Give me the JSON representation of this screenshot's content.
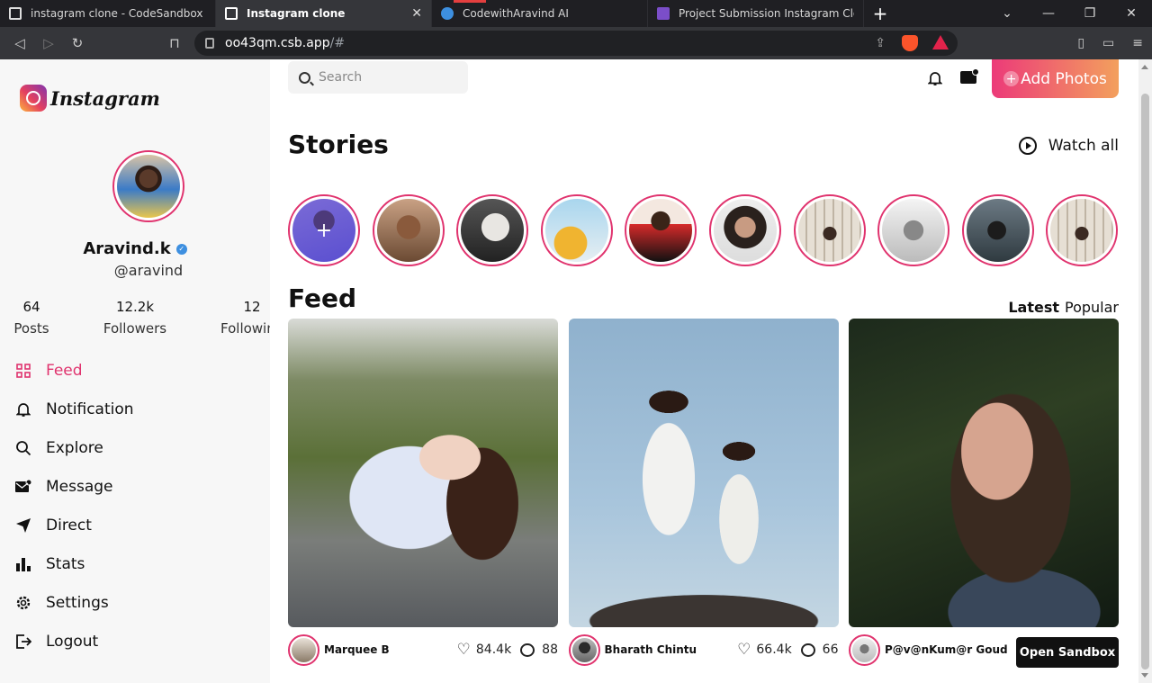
{
  "browser": {
    "tabs": [
      {
        "title": "instagram clone - CodeSandbox",
        "active": false
      },
      {
        "title": "Instagram clone",
        "active": true
      },
      {
        "title": "CodewithAravind AI",
        "active": false
      },
      {
        "title": "Project Submission Instagram Clone |",
        "active": false
      }
    ],
    "new_tab": "+",
    "url_host": "oo43qm.csb.app",
    "url_path": "/#"
  },
  "sidebar": {
    "logo_text": "Instagram",
    "profile": {
      "name": "Aravind.k",
      "handle": "@aravind"
    },
    "stats": [
      {
        "value": "64",
        "label": "Posts"
      },
      {
        "value": "12.2k",
        "label": "Followers"
      },
      {
        "value": "12",
        "label": "Following"
      }
    ],
    "menu": [
      {
        "label": "Feed",
        "icon": "grid-icon",
        "active": true
      },
      {
        "label": "Notification",
        "icon": "bell-icon",
        "active": false
      },
      {
        "label": "Explore",
        "icon": "search-icon",
        "active": false
      },
      {
        "label": "Message",
        "icon": "mail-icon",
        "active": false
      },
      {
        "label": "Direct",
        "icon": "send-icon",
        "active": false
      },
      {
        "label": "Stats",
        "icon": "bar-chart-icon",
        "active": false
      },
      {
        "label": "Settings",
        "icon": "gear-icon",
        "active": false
      },
      {
        "label": "Logout",
        "icon": "logout-icon",
        "active": false
      }
    ]
  },
  "header": {
    "search_placeholder": "Search",
    "add_photos": "Add Photos",
    "accent_gradient": [
      "#ec3a79",
      "#f3a05d"
    ]
  },
  "stories": {
    "title": "Stories",
    "watch_all": "Watch all",
    "add_icon": "+",
    "count": 10
  },
  "feed": {
    "title": "Feed",
    "tabs": [
      "Latest",
      "Popular"
    ],
    "posts": [
      {
        "author": "Marquee B",
        "likes": "84.4k",
        "comments": "88"
      },
      {
        "author": "Bharath Chintu",
        "likes": "66.4k",
        "comments": "66"
      },
      {
        "author": "P@v@nKum@r Goud"
      }
    ]
  },
  "open_sandbox": "Open Sandbox",
  "accent_color": "#e0336e"
}
